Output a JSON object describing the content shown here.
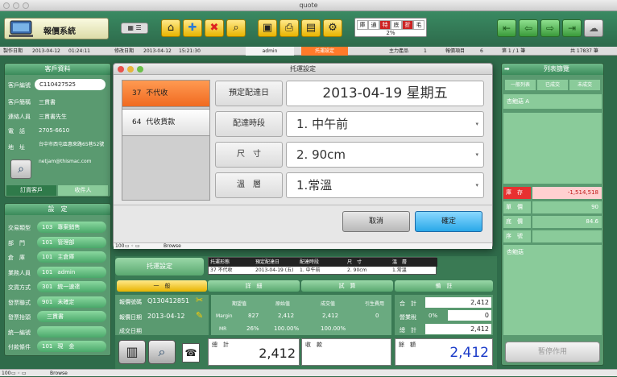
{
  "window": {
    "title": "quote"
  },
  "app": {
    "title": "報價系統"
  },
  "tag": {
    "cells": [
      "庫",
      "通",
      "特",
      "底",
      "折",
      "毛"
    ],
    "percent": "2%"
  },
  "info": {
    "created_label": "製作日期",
    "created_date": "2013-04-12",
    "created_time": "01:24:11",
    "modified_label": "修改日期",
    "modified_date": "2013-04-12",
    "modified_time": "15:21:30",
    "user": "admin",
    "tab": "托運設定",
    "mainfile_label": "主力產品",
    "mainfile_val": "1",
    "items_label": "報價項目",
    "items_val": "6",
    "page": "第 1 / 1 筆",
    "total": "共 17837 筆"
  },
  "customer": {
    "header": "客戶資料",
    "code_label": "客戶編號",
    "code": "C110427525",
    "name_label": "客戶簡稱",
    "name": "三貫書",
    "contact_label": "連絡人員",
    "contact": "三貫書先生",
    "phone_label": "電　話",
    "phone": "2705-6610",
    "addr_label": "地　址",
    "addr": "台中市西屯區惠來路65巷52號",
    "email": "netjam@thismac.com",
    "tab1": "訂貨客戶",
    "tab2": "收件人"
  },
  "settings": {
    "header": "設　定",
    "rows": [
      {
        "label": "交易類型",
        "code": "103",
        "value": "專案銷售"
      },
      {
        "label": "部　門",
        "code": "101",
        "value": "管理部"
      },
      {
        "label": "倉　庫",
        "code": "101",
        "value": "主倉庫"
      },
      {
        "label": "業務人員",
        "code": "101",
        "value": "admin"
      },
      {
        "label": "交貨方式",
        "code": "301",
        "value": "統一速達"
      },
      {
        "label": "發票聯式",
        "code": "901",
        "value": "未確定"
      },
      {
        "label": "發票抬頭",
        "code": "",
        "value": "三貫書"
      },
      {
        "label": "統一編號",
        "code": "",
        "value": ""
      },
      {
        "label": "付款條件",
        "code": "101",
        "value": "現　金"
      }
    ]
  },
  "dialog": {
    "title": "托運設定",
    "options": [
      {
        "code": "37",
        "label": "不代收"
      },
      {
        "code": "64",
        "label": "代收貨款"
      }
    ],
    "fields": [
      {
        "label": "預定配達日",
        "value": "2013-04-19  星期五"
      },
      {
        "label": "配達時段",
        "value": "1. 中午前"
      },
      {
        "label": "尺　寸",
        "value": "2. 90cm"
      },
      {
        "label": "溫　層",
        "value": "1.常溫"
      }
    ],
    "cancel": "取消",
    "ok": "確定"
  },
  "status": {
    "zoom1": "100",
    "mode1": "Browse",
    "zoom2": "100",
    "mode2": "Browse"
  },
  "ship": {
    "btn": "托運設定",
    "headers": [
      "托運形態",
      "預定配達日",
      "配達時段",
      "尺　寸",
      "溫　層"
    ],
    "row": [
      "37 不代收",
      "2013-04-19 (五)",
      "1. 中午前",
      "2. 90cm",
      "1.常溫"
    ]
  },
  "tabs": [
    "一　般",
    "詳　細",
    "試　算",
    "備　註"
  ],
  "quote": {
    "no_label": "報價號碼",
    "no": "Q130412851",
    "date_label": "報價日期",
    "date": "2013-04-12",
    "deal_label": "成交日期",
    "deal": ""
  },
  "calc": {
    "h1": "期望值",
    "h2": "原始值",
    "h3": "成交值",
    "h4": "引生費用",
    "margin_label": "Margin",
    "margin_exp": "827",
    "margin_orig": "2,412",
    "margin_deal": "2,412",
    "margin_fee": "0",
    "mr_label": "MR",
    "mr_exp": "26%",
    "mr_orig": "100.00%",
    "mr_deal": "100.00%"
  },
  "sums": {
    "sum_label": "合　計",
    "sum": "2,412",
    "tax_label": "營業稅",
    "tax_pct": "0%",
    "tax": "0",
    "total_label": "總　計",
    "total": "2,412"
  },
  "bottom": {
    "total_label": "總　計",
    "total": "2,412",
    "recv_label": "收　款",
    "recv": "",
    "bal_label": "餘　額",
    "bal": "2,412"
  },
  "right": {
    "header": "列表篩覽",
    "filters": [
      "一般列表",
      "已成交",
      "未成交"
    ],
    "item": "杏鮑菇 A",
    "rows": [
      {
        "label": "庫　存",
        "value": "-1,514,518"
      },
      {
        "label": "單　價",
        "value": "90"
      },
      {
        "label": "底　價",
        "value": "84.6"
      },
      {
        "label": "序　號",
        "value": ""
      }
    ],
    "note": "杏鮑菇",
    "stop": "暫停作用"
  }
}
